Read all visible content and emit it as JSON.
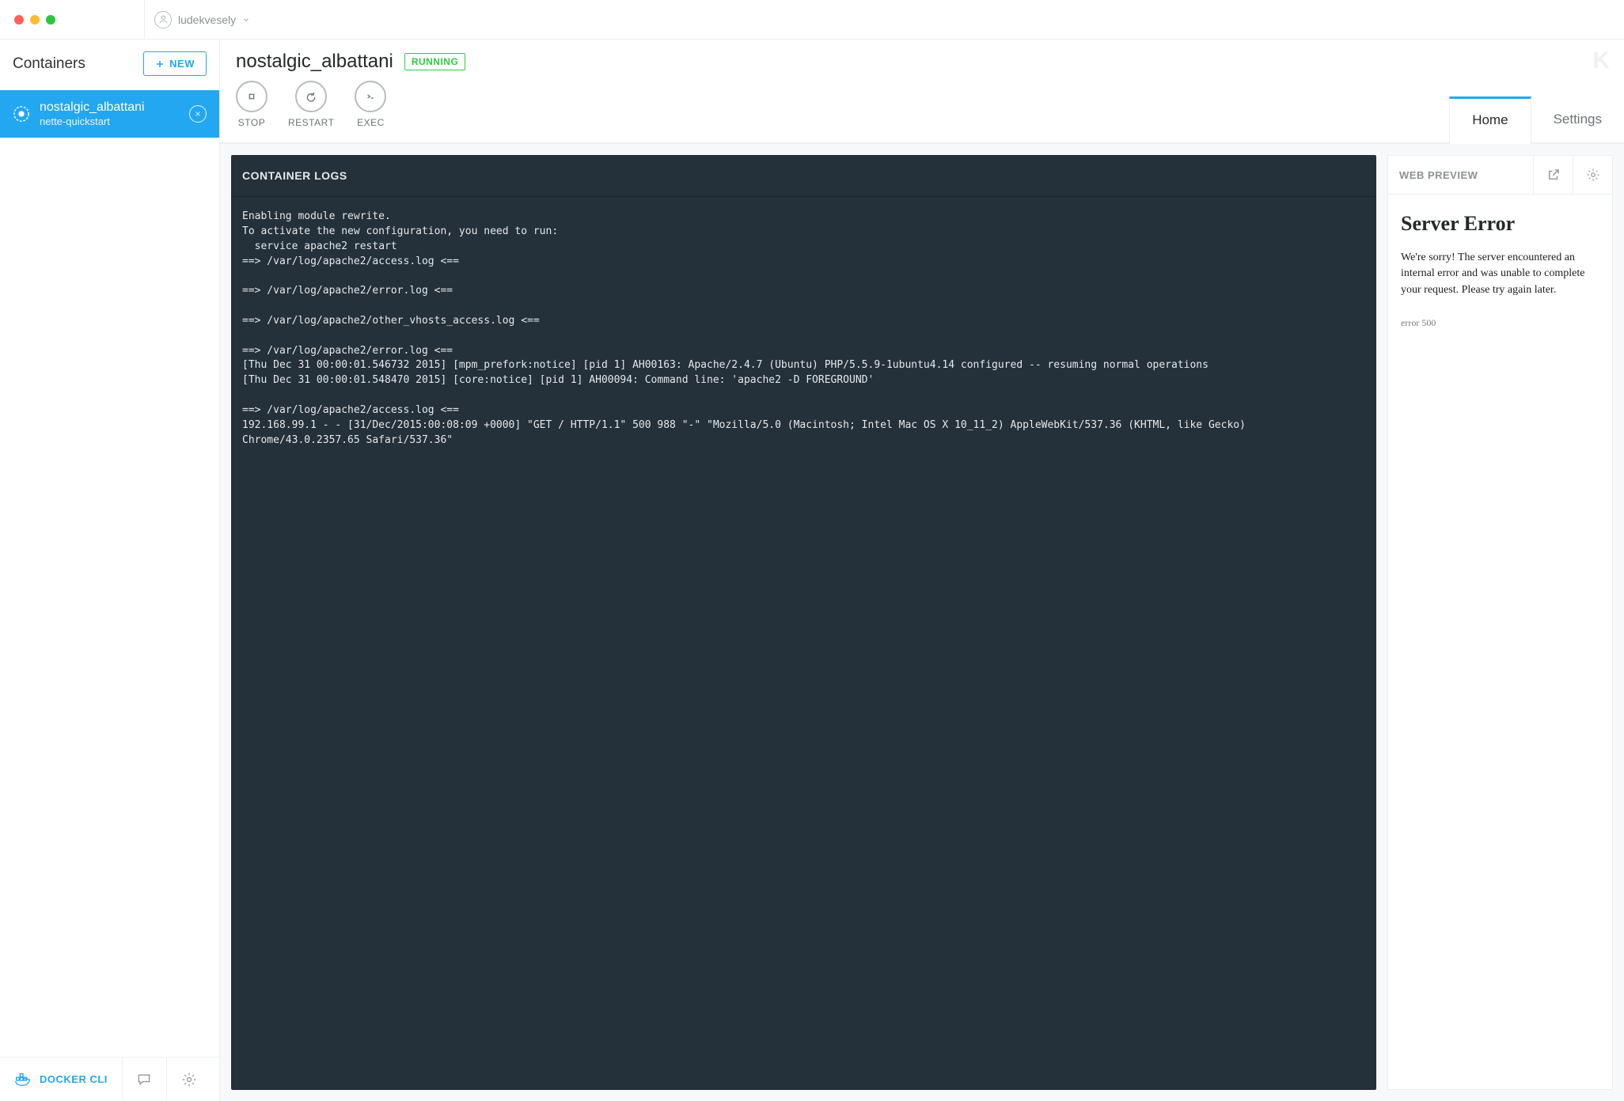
{
  "user": {
    "name": "ludekvesely"
  },
  "sidebar": {
    "title": "Containers",
    "new_label": "NEW",
    "items": [
      {
        "name": "nostalgic_albattani",
        "image": "nette-quickstart"
      }
    ],
    "docker_cli_label": "DOCKER CLI"
  },
  "header": {
    "container_name": "nostalgic_albattani",
    "status": "RUNNING"
  },
  "actions": {
    "stop": "STOP",
    "restart": "RESTART",
    "exec": "EXEC"
  },
  "tabs": {
    "home": "Home",
    "settings": "Settings"
  },
  "logs": {
    "title": "CONTAINER LOGS",
    "text": "Enabling module rewrite.\nTo activate the new configuration, you need to run:\n  service apache2 restart\n==> /var/log/apache2/access.log <==\n\n==> /var/log/apache2/error.log <==\n\n==> /var/log/apache2/other_vhosts_access.log <==\n\n==> /var/log/apache2/error.log <==\n[Thu Dec 31 00:00:01.546732 2015] [mpm_prefork:notice] [pid 1] AH00163: Apache/2.4.7 (Ubuntu) PHP/5.5.9-1ubuntu4.14 configured -- resuming normal operations\n[Thu Dec 31 00:00:01.548470 2015] [core:notice] [pid 1] AH00094: Command line: 'apache2 -D FOREGROUND'\n\n==> /var/log/apache2/access.log <==\n192.168.99.1 - - [31/Dec/2015:00:08:09 +0000] \"GET / HTTP/1.1\" 500 988 \"-\" \"Mozilla/5.0 (Macintosh; Intel Mac OS X 10_11_2) AppleWebKit/537.36 (KHTML, like Gecko) Chrome/43.0.2357.65 Safari/537.36\""
  },
  "preview": {
    "title": "WEB PREVIEW",
    "heading": "Server Error",
    "body": "We're sorry! The server encountered an internal error and was unable to complete your request. Please try again later.",
    "error_code": "error 500"
  }
}
